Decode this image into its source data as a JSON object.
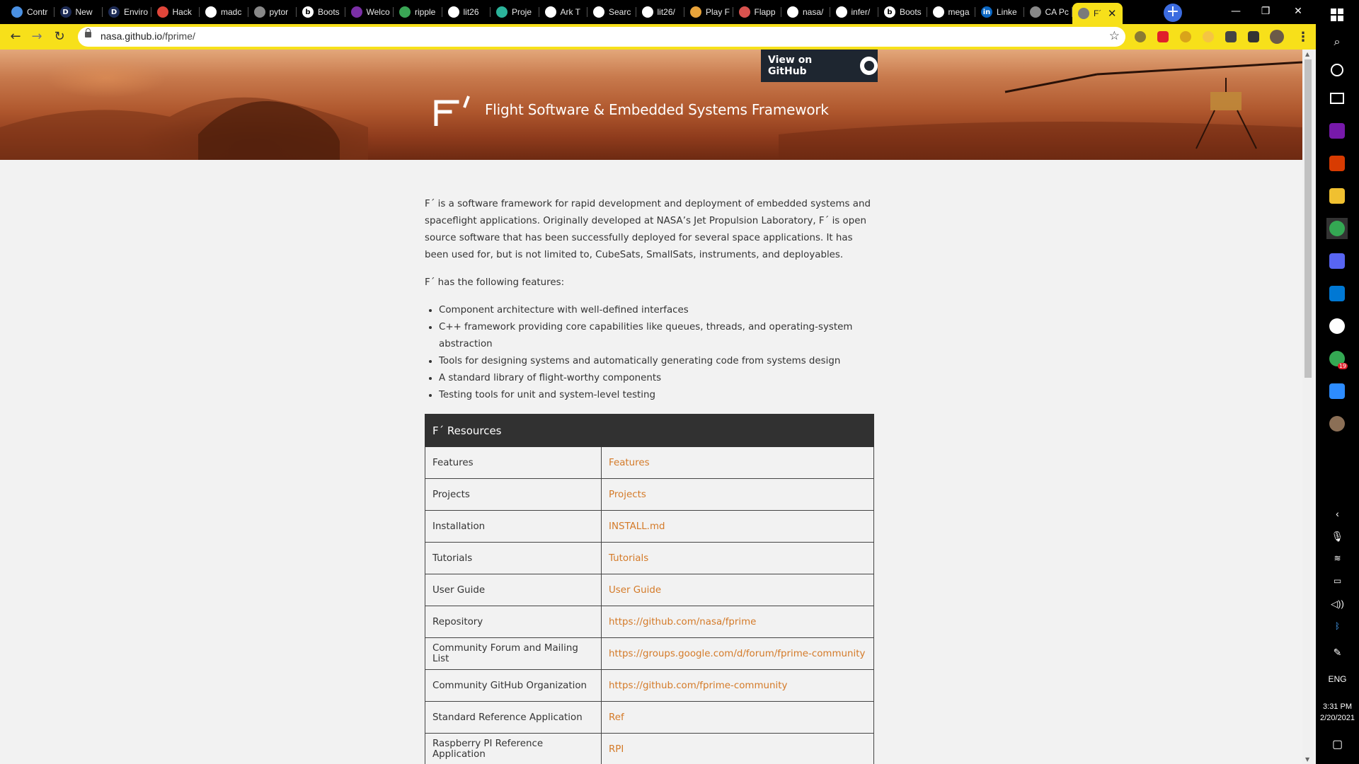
{
  "browser": {
    "tabs": [
      {
        "title": "Contr",
        "color": "#4a90e2",
        "glyph": ""
      },
      {
        "title": "New",
        "color": "#1d2b55",
        "glyph": "D"
      },
      {
        "title": "Enviro",
        "color": "#1d2b55",
        "glyph": "D"
      },
      {
        "title": "Hack",
        "color": "#e0463a",
        "glyph": ""
      },
      {
        "title": "madc",
        "color": "#ffffff",
        "glyph": ""
      },
      {
        "title": "pytor",
        "color": "#888888",
        "glyph": ""
      },
      {
        "title": "Boots",
        "color": "#ffffff",
        "glyph": "b"
      },
      {
        "title": "Welco",
        "color": "#7b2fa6",
        "glyph": ""
      },
      {
        "title": "ripple",
        "color": "#3aa655",
        "glyph": ""
      },
      {
        "title": "lit26",
        "color": "#ffffff",
        "glyph": ""
      },
      {
        "title": "Proje",
        "color": "#2bb39a",
        "glyph": ""
      },
      {
        "title": "Ark T",
        "color": "#ffffff",
        "glyph": ""
      },
      {
        "title": "Searc",
        "color": "#ffffff",
        "glyph": ""
      },
      {
        "title": "lit26/",
        "color": "#ffffff",
        "glyph": ""
      },
      {
        "title": "Play F",
        "color": "#e8a33a",
        "glyph": ""
      },
      {
        "title": "Flapp",
        "color": "#d9534f",
        "glyph": ""
      },
      {
        "title": "nasa/",
        "color": "#ffffff",
        "glyph": ""
      },
      {
        "title": "infer/",
        "color": "#ffffff",
        "glyph": ""
      },
      {
        "title": "Boots",
        "color": "#ffffff",
        "glyph": "b"
      },
      {
        "title": "mega",
        "color": "#ffffff",
        "glyph": ""
      },
      {
        "title": "Linke",
        "color": "#0a66c2",
        "glyph": "in"
      },
      {
        "title": "CA Pc",
        "color": "#888888",
        "glyph": ""
      },
      {
        "title": "F´",
        "color": "#7a7a7a",
        "glyph": ""
      }
    ],
    "new_tab_symbol": "+",
    "window_controls": [
      "—",
      "❐",
      "✕"
    ],
    "url_host": "nasa.github.io",
    "url_path": "/fprime/",
    "accent_color": "#f7e01a"
  },
  "site": {
    "github_button": "View on GitHub",
    "title": "Flight Software & Embedded Systems Framework",
    "intro": "F´ is a software framework for rapid development and deployment of embedded systems and spaceflight applications. Originally developed at NASA’s Jet Propulsion Laboratory, F´ is open source software that has been successfully deployed for several space applications. It has been used for, but is not limited to, CubeSats, SmallSats, instruments, and deployables.",
    "features_heading": "F´ has the following features:",
    "features": [
      "Component architecture with well-defined interfaces",
      "C++ framework providing core capabilities like queues, threads, and operating-system abstraction",
      "Tools for designing systems and automatically generating code from systems design",
      "A standard library of flight-worthy components",
      "Testing tools for unit and system-level testing"
    ],
    "resources_heading": "F´ Resources",
    "resources": [
      {
        "name": "Features",
        "link": "Features"
      },
      {
        "name": "Projects",
        "link": "Projects"
      },
      {
        "name": "Installation",
        "link": "INSTALL.md"
      },
      {
        "name": "Tutorials",
        "link": "Tutorials"
      },
      {
        "name": "User Guide",
        "link": "User Guide"
      },
      {
        "name": "Repository",
        "link": "https://github.com/nasa/fprime"
      },
      {
        "name": "Community Forum and Mailing List",
        "link": "https://groups.google.com/d/forum/fprime-community"
      },
      {
        "name": "Community GitHub Organization",
        "link": "https://github.com/fprime-community"
      },
      {
        "name": "Standard Reference Application",
        "link": "Ref"
      },
      {
        "name": "Raspberry PI Reference Application",
        "link": "RPI"
      }
    ],
    "link_color": "#d47a28"
  },
  "taskbar": {
    "language": "ENG",
    "time": "3:31 PM",
    "date": "2/20/2021",
    "badge_count": "19"
  }
}
